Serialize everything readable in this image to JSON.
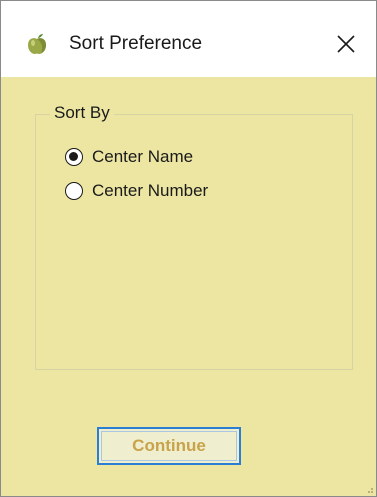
{
  "window": {
    "title": "Sort Preference",
    "app_icon": "apple-icon",
    "close_icon": "close-icon"
  },
  "sort_group": {
    "label": "Sort By",
    "options": [
      {
        "label": "Center Name",
        "selected": true
      },
      {
        "label": "Center Number",
        "selected": false
      }
    ]
  },
  "actions": {
    "continue_label": "Continue"
  },
  "colors": {
    "background": "#ede6a3",
    "button_border": "#2a7fd4",
    "button_text": "#c9a34a"
  }
}
